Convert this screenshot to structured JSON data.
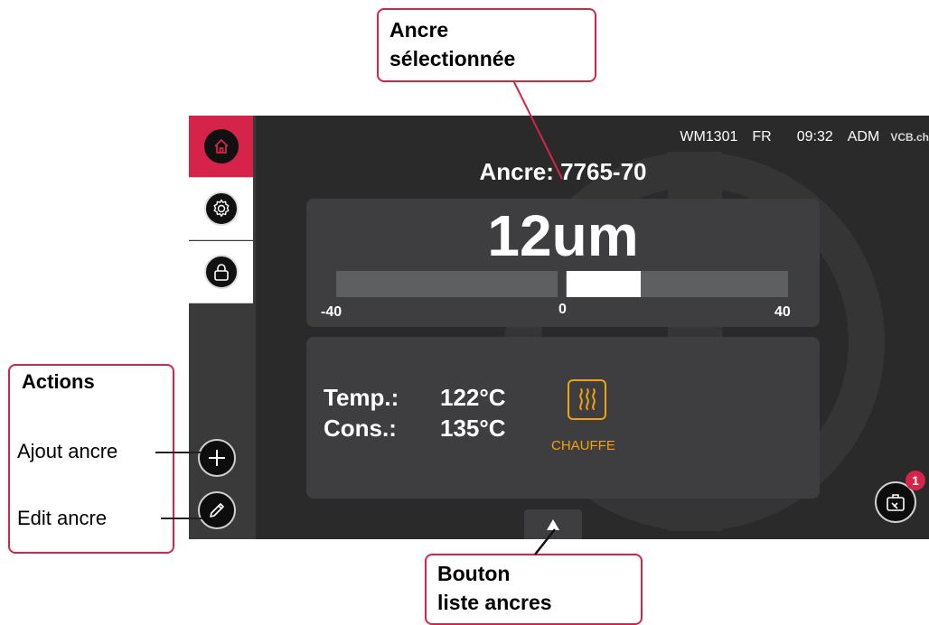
{
  "status_bar": {
    "device": "WM1301",
    "language": "FR",
    "time": "09:32",
    "user": "ADM",
    "logo": "VCB.ch"
  },
  "sidebar": {
    "items": [
      {
        "name": "home",
        "icon": "home-icon",
        "active": true
      },
      {
        "name": "settings",
        "icon": "gear-icon",
        "active": false
      },
      {
        "name": "lock",
        "icon": "lock-icon",
        "active": false
      }
    ]
  },
  "anchor": {
    "title": "Ancre: 7765-70"
  },
  "measurement": {
    "value": "12um",
    "gauge_min_label": "-40",
    "gauge_zero_label": "0",
    "gauge_max_label": "40",
    "gauge_min": -40,
    "gauge_max": 40,
    "gauge_value": 12
  },
  "temperature": {
    "temp_label": "Temp.:",
    "temp_value": "122°C",
    "setpoint_label": "Cons.:",
    "setpoint_value": "135°C",
    "heating_icon": "heater-icon",
    "heating_status": "CHAUFFE"
  },
  "notifications": {
    "count": "1"
  },
  "colors": {
    "accent": "#d6234a",
    "heating": "#f2a113",
    "screen_bg": "#2a2a2b",
    "card_bg": "#3e3e40"
  },
  "annotations": {
    "selected_anchor": [
      "Ancre",
      "sélectionnée"
    ],
    "actions_title": "Actions",
    "add_anchor": "Ajout ancre",
    "edit_anchor": "Edit ancre",
    "list_button": [
      "Bouton",
      "liste ancres"
    ]
  }
}
